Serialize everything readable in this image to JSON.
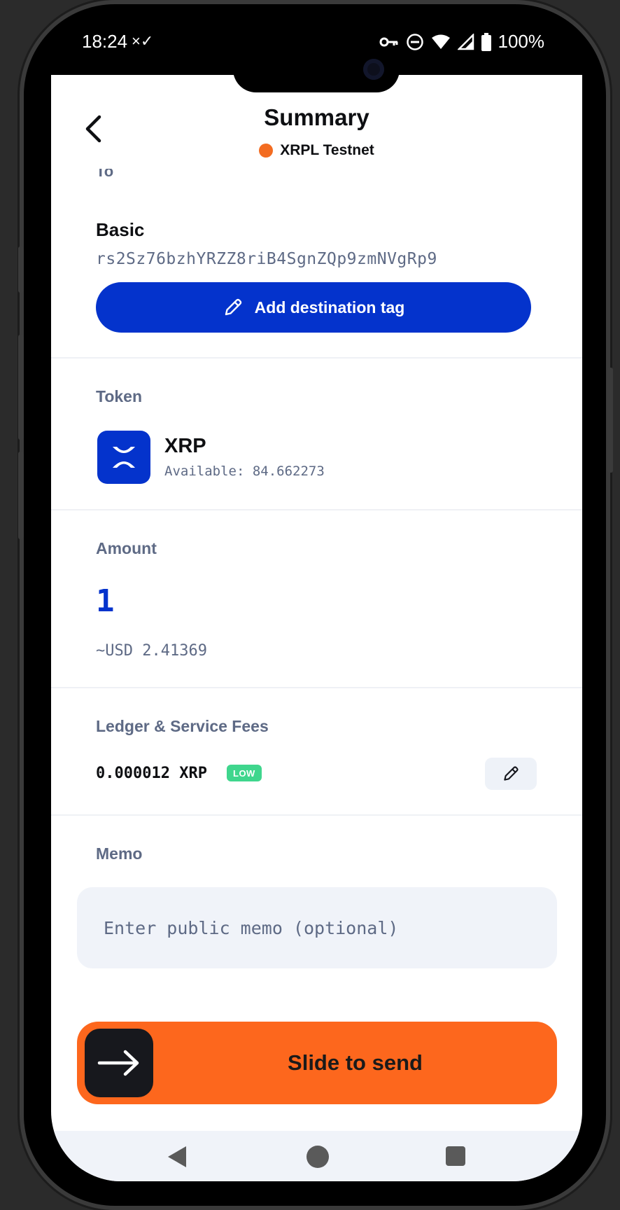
{
  "status_bar": {
    "time": "18:24",
    "notification_icons": "×✓",
    "battery": "100%"
  },
  "header": {
    "title": "Summary",
    "network": "XRPL Testnet",
    "network_color": "#f36c21"
  },
  "recipient": {
    "section_label": "To",
    "name": "Basic",
    "address": "rs2Sz76bzhYRZZ8riB4SgnZQp9zmNVgRp9",
    "add_tag_label": "Add destination tag"
  },
  "token": {
    "section_label": "Token",
    "symbol": "XRP",
    "available": "Available: 84.662273"
  },
  "amount": {
    "section_label": "Amount",
    "value": "1",
    "fiat": "~USD 2.41369"
  },
  "fees": {
    "section_label": "Ledger & Service Fees",
    "value": "0.000012 XRP",
    "badge": "LOW"
  },
  "memo": {
    "section_label": "Memo",
    "placeholder": "Enter public memo (optional)"
  },
  "send": {
    "label": "Slide to send"
  },
  "colors": {
    "accent_blue": "#0433cc",
    "send_orange": "#fd671d",
    "label_gray": "#5e6a85",
    "badge_green": "#3fd68d"
  },
  "icons": {
    "back": "chevron-left-icon",
    "edit": "pencil-icon",
    "token": "xrp-logo-icon",
    "slide": "arrow-right-icon"
  }
}
